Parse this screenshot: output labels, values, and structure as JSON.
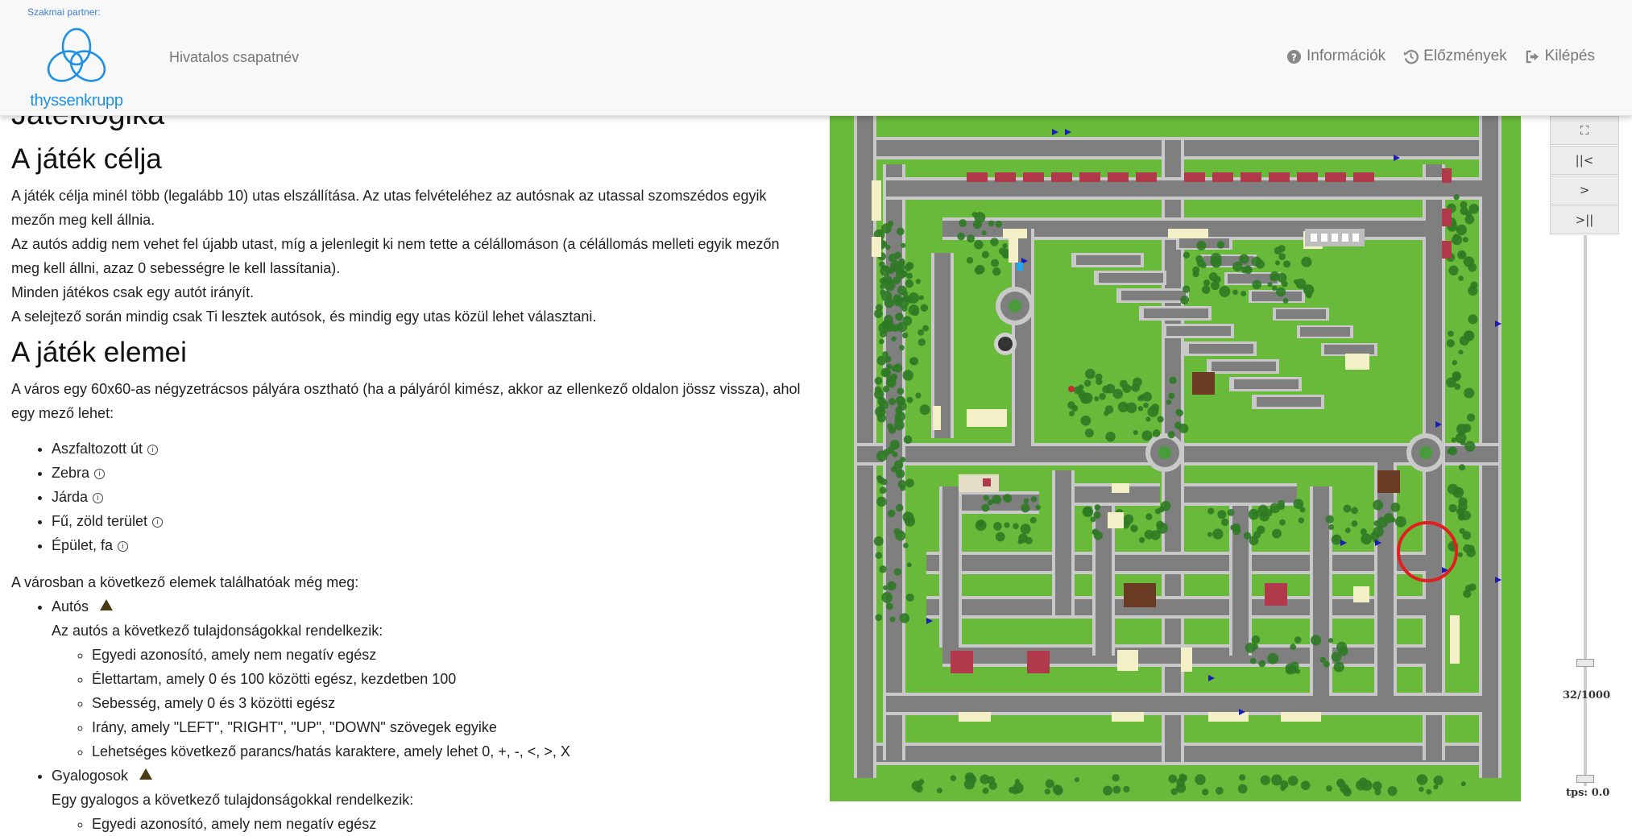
{
  "header": {
    "partner_label": "Szakmai partner:",
    "brand_name": "thyssenkrupp",
    "team_name": "Hivatalos csapatnév",
    "nav": [
      {
        "label": "Információk",
        "icon": "question-circle-icon"
      },
      {
        "label": "Előzmények",
        "icon": "history-icon"
      },
      {
        "label": "Kilépés",
        "icon": "sign-out-icon"
      }
    ]
  },
  "doc": {
    "cut_heading": "Játéklogika",
    "goal_heading": "A játék célja",
    "goal_paragraphs": [
      "A játék célja minél több (legalább 10) utas elszállítása. Az utas felvételéhez az autósnak az utassal szomszédos egyik mezőn meg kell állnia.",
      "Az autós addig nem vehet fel újabb utast, míg a jelenlegit ki nem tette a célállomáson (a célállomás melleti egyik mezőn meg kell állni, azaz 0 sebességre le kell lassítania).",
      "Minden játékos csak egy autót irányít.",
      "A selejtező során mindig csak Ti lesztek autósok, és mindig egy utas közül lehet választani."
    ],
    "elements_heading": "A játék elemei",
    "city_text": "A város egy 60x60-as négyzetrácsos pályára osztható (ha a pályáról kimész, akkor az ellenkező oldalon jössz vissza), ahol egy mező lehet:",
    "field_types": [
      "Aszfaltozott út",
      "Zebra",
      "Járda",
      "Fű, zöld terület",
      "Épület, fa"
    ],
    "more_text": "A városban a következő elemek találhatóak még meg:",
    "cars_label": "Autós",
    "cars_desc": "Az autós a következő tulajdonságokkal rendelkezik:",
    "car_props": [
      "Egyedi azonosító, amely nem negatív egész",
      "Élettartam, amely 0 és 100 közötti egész, kezdetben 100",
      "Sebesség, amely 0 és 3 közötti egész",
      "Irány, amely \"LEFT\", \"RIGHT\", \"UP\", \"DOWN\" szövegek egyike",
      "Lehetséges következő parancs/hatás karaktere, amely lehet 0, +, -, <, >, X"
    ],
    "ped_label": "Gyalogosok",
    "ped_desc": "Egy gyalogos a következő tulajdonságokkal rendelkezik:",
    "ped_props": [
      "Egyedi azonosító, amely nem negatív egész"
    ]
  },
  "controls": {
    "buttons": [
      "⛶",
      "||<",
      ">",
      ">||"
    ],
    "tick_display": "32/1000",
    "tick_current": 32,
    "tick_max": 1000,
    "tps_label": "tps: 0.0"
  },
  "colors": {
    "grass": "#69b93b",
    "road": "#7f7f7f",
    "sidewalk": "#c9c9c9",
    "brand_blue": "#1e90e6",
    "highlight_circle": "#e02020"
  }
}
